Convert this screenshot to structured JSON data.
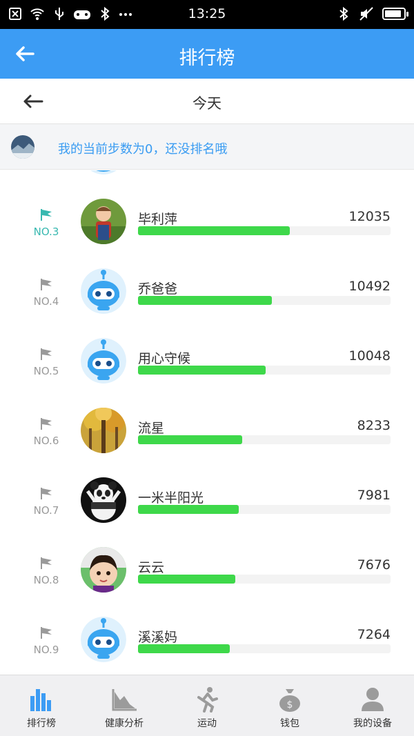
{
  "status_bar": {
    "time": "13:25"
  },
  "app_bar": {
    "title": "排行榜"
  },
  "date_nav": {
    "label": "今天"
  },
  "my_info": {
    "text": "我的当前步数为0，还没排名哦"
  },
  "colors": {
    "primary": "#3c9cf4",
    "bar": "#3ed84a",
    "rank_highlight": "#38b8b0"
  },
  "ranking": [
    {
      "rank": "NO.3",
      "name": "毕利萍",
      "steps": "12035",
      "progress": 0.6,
      "avatar": "child-photo"
    },
    {
      "rank": "NO.4",
      "name": "乔爸爸",
      "steps": "10492",
      "progress": 0.53,
      "avatar": "robot-default"
    },
    {
      "rank": "NO.5",
      "name": "用心守候",
      "steps": "10048",
      "progress": 0.505,
      "avatar": "robot-default"
    },
    {
      "rank": "NO.6",
      "name": "流星",
      "steps": "8233",
      "progress": 0.413,
      "avatar": "forest-photo"
    },
    {
      "rank": "NO.7",
      "name": "一米半阳光",
      "steps": "7981",
      "progress": 0.4,
      "avatar": "panda-photo"
    },
    {
      "rank": "NO.8",
      "name": "云云",
      "steps": "7676",
      "progress": 0.385,
      "avatar": "girl-photo"
    },
    {
      "rank": "NO.9",
      "name": "溪溪妈",
      "steps": "7264",
      "progress": 0.364,
      "avatar": "robot-default"
    }
  ],
  "tabs": [
    {
      "label": "排行榜",
      "icon": "bar-chart-icon",
      "active": true
    },
    {
      "label": "健康分析",
      "icon": "area-chart-icon",
      "active": false
    },
    {
      "label": "运动",
      "icon": "runner-icon",
      "active": false
    },
    {
      "label": "钱包",
      "icon": "money-bag-icon",
      "active": false
    },
    {
      "label": "我的设备",
      "icon": "person-icon",
      "active": false
    }
  ]
}
